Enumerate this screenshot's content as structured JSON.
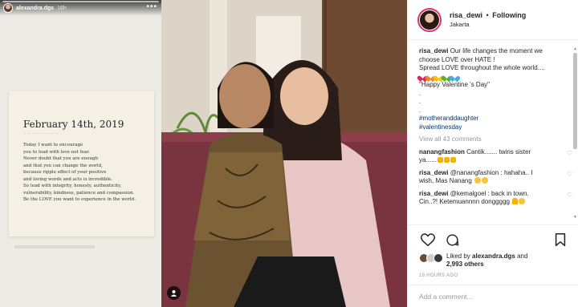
{
  "story": {
    "username": "alexandra.dgs",
    "time": "16h",
    "menu_icon": "more-dots-icon",
    "card": {
      "date": "February 14th, 2019",
      "lines": [
        "Today I want to encourage",
        "you to lead with love not fear.",
        "Never doubt that you are enough",
        "and that you can change the world,",
        "because ripple effect of your positive",
        "and loving words and acts is incredible.",
        "So lead with integrity, honesty, authenticity,",
        "vulnerability, kindness, patience and compassion.",
        "Be the LOVE you want to experience in the world."
      ]
    }
  },
  "post": {
    "username": "risa_dewi",
    "dot": "•",
    "follow_label": "Following",
    "location": "Jakarta",
    "caption_user": "risa_dewi",
    "caption_lines": [
      "Our life changes the moment we",
      "choose LOVE over HATE !",
      "Spread LOVE throughout the whole world...."
    ],
    "heart_colors": [
      "#e0245e",
      "#f5832a",
      "#f6c20b",
      "#5bb32d",
      "#4aa7e8"
    ],
    "valentine": "\"Happy Valentine 's Day\"",
    "dots": [
      ".",
      ".",
      "."
    ],
    "hashtags": [
      "#motheranddaughter",
      "#valentinesday"
    ],
    "view_all": "View all 43 comments",
    "comments": [
      {
        "user": "nanangfashion",
        "text1": "Cantik....... twins sister",
        "text2": "ya......"
      },
      {
        "user": "risa_dewi",
        "text1": "@nanangfashion : hahaha.. I",
        "text2": "wish, Mas Nanang"
      },
      {
        "user": "risa_dewi",
        "text1": "@kemalgoel : back in town.",
        "text2": "Cin..?! Ketemuannnn donggggg"
      }
    ],
    "liked_by_prefix": "Liked by",
    "liked_by_user": "alexandra.dgs",
    "liked_by_and": "and",
    "others": "2,993 others",
    "time_ago": "18 HOURS AGO",
    "comment_placeholder": "Add a comment...",
    "icons": [
      "heart-icon",
      "comment-icon",
      "bookmark-icon",
      "tag-people-icon"
    ]
  }
}
